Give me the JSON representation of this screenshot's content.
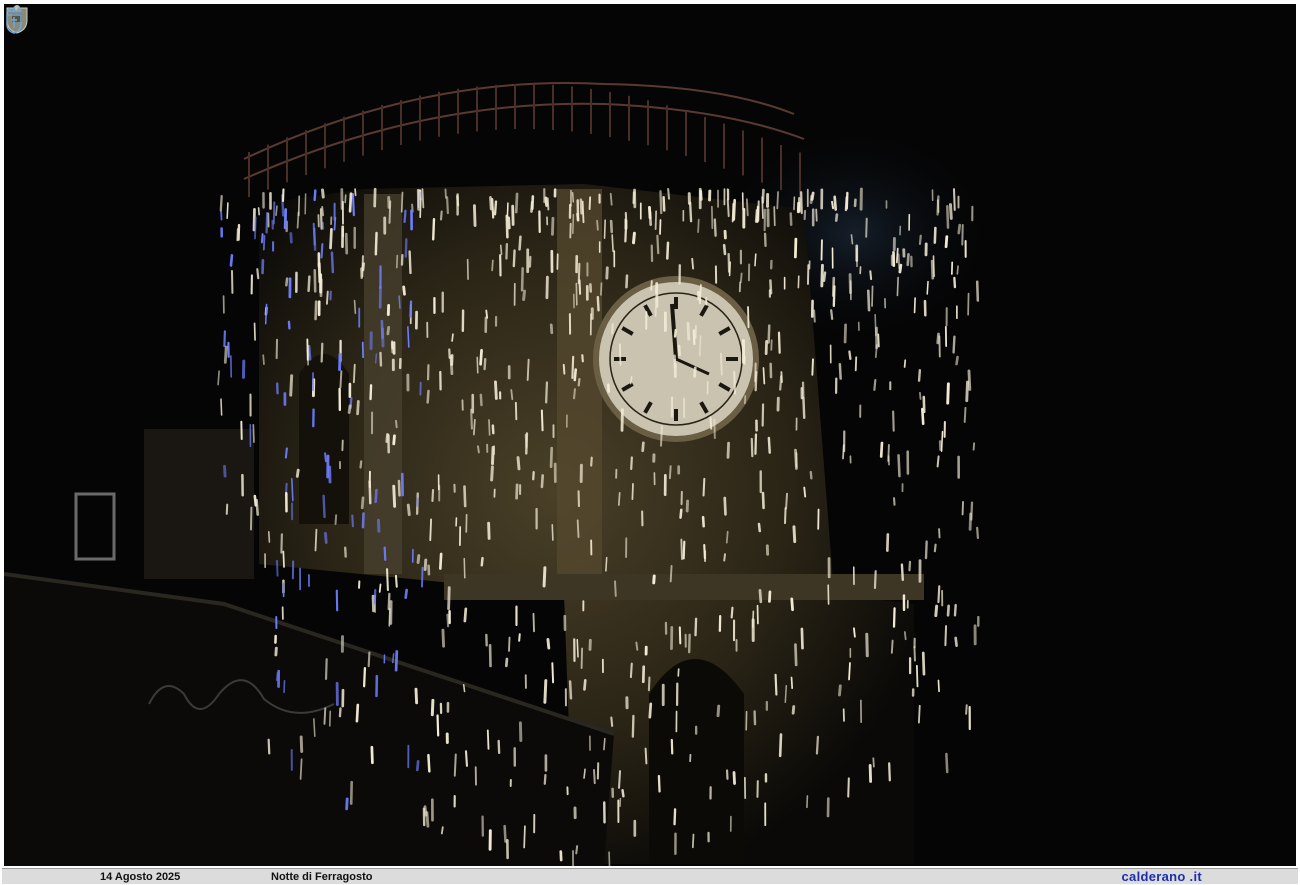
{
  "photo": {
    "subject": "bell-tower-fireworks-photo",
    "colors": {
      "sky": "#050506",
      "tower": "#3a3322",
      "sparks": "#f4ecd6",
      "sparks_blue": "#6a7cff"
    }
  },
  "footer": {
    "date": "14 Agosto 2025",
    "caption": "Notte di Ferragosto",
    "site": "calderano .it"
  },
  "icons": {
    "top_left": "crest-watermark-icon",
    "bottom_right": "crown-logo-icon"
  }
}
